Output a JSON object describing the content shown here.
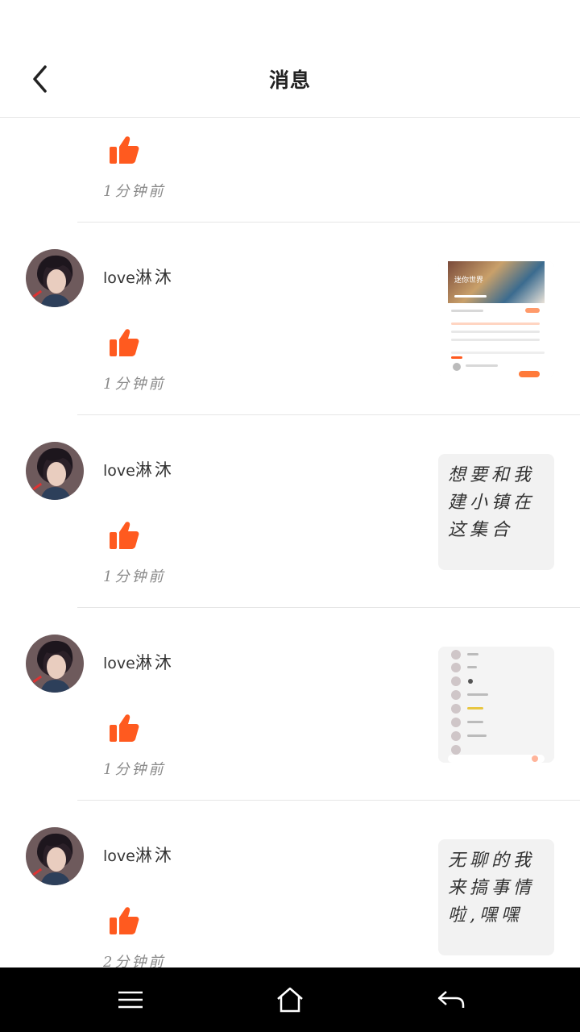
{
  "header": {
    "title": "消息"
  },
  "items": [
    {
      "username_latin": "",
      "username_cn": "",
      "time": "1分钟前",
      "thumb_type": "screenshot-profile"
    },
    {
      "username_latin": "love",
      "username_cn": "淋沐",
      "time": "1分钟前",
      "thumb_type": "screenshot-world",
      "thumb_caption": "迷你世界"
    },
    {
      "username_latin": "love",
      "username_cn": "淋沐",
      "time": "1分钟前",
      "thumb_type": "text",
      "thumb_text": "想要和我建小镇在这集合"
    },
    {
      "username_latin": "love",
      "username_cn": "淋沐",
      "time": "1分钟前",
      "thumb_type": "screenshot-list"
    },
    {
      "username_latin": "love",
      "username_cn": "淋沐",
      "time": "2分钟前",
      "thumb_type": "text",
      "thumb_text": "无聊的我来搞事情啦,嘿嘿"
    }
  ],
  "colors": {
    "accent": "#ff5a1f",
    "divider": "#e6e6e6",
    "thumb_bg": "#f2f2f2",
    "navbar": "#000000"
  },
  "icons": {
    "back": "chevron-left-icon",
    "like": "thumbs-up-icon",
    "menu": "menu-icon",
    "home": "home-icon",
    "return": "back-arrow-icon"
  }
}
